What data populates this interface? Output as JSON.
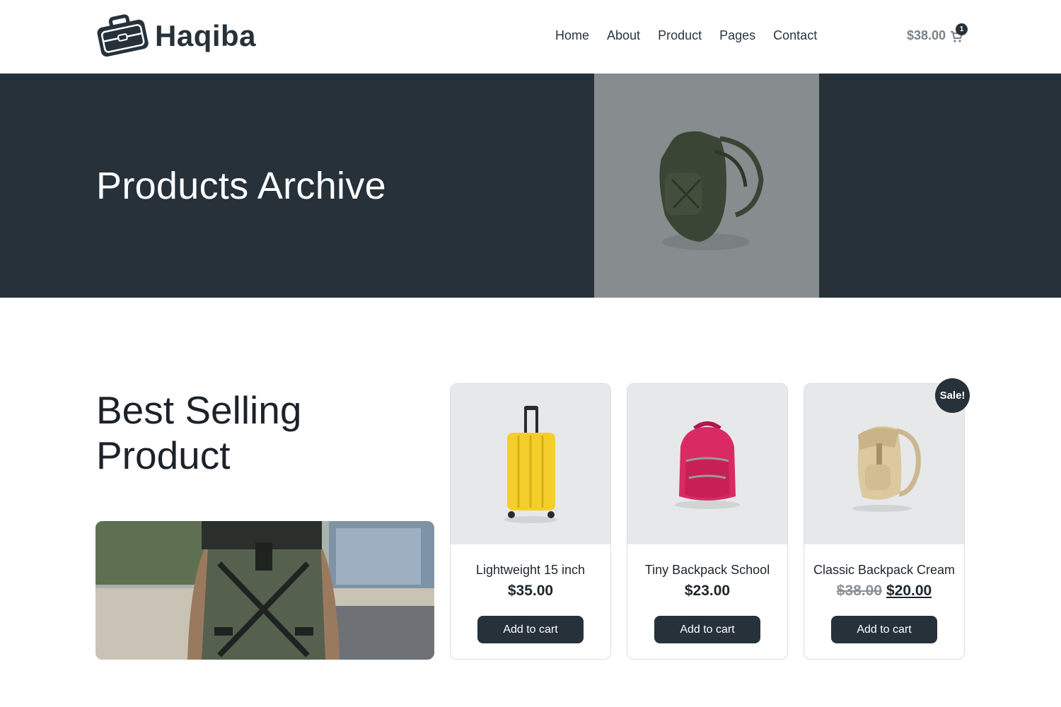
{
  "brand": {
    "name": "Haqiba",
    "accent": "#26313a"
  },
  "nav": {
    "items": [
      "Home",
      "About",
      "Product",
      "Pages",
      "Contact"
    ]
  },
  "cart": {
    "total": "$38.00",
    "count": "1"
  },
  "hero": {
    "title": "Products Archive"
  },
  "section": {
    "title_line1": "Best Selling",
    "title_line2": "Product"
  },
  "products": [
    {
      "name": "Lightweight 15 inch",
      "price": "$35.00",
      "button": "Add to cart"
    },
    {
      "name": "Tiny Backpack School",
      "price": "$23.00",
      "button": "Add to cart"
    },
    {
      "name": "Classic Backpack Cream",
      "old_price": "$38.00",
      "price": "$20.00",
      "button": "Add to cart",
      "badge": "Sale!"
    }
  ]
}
